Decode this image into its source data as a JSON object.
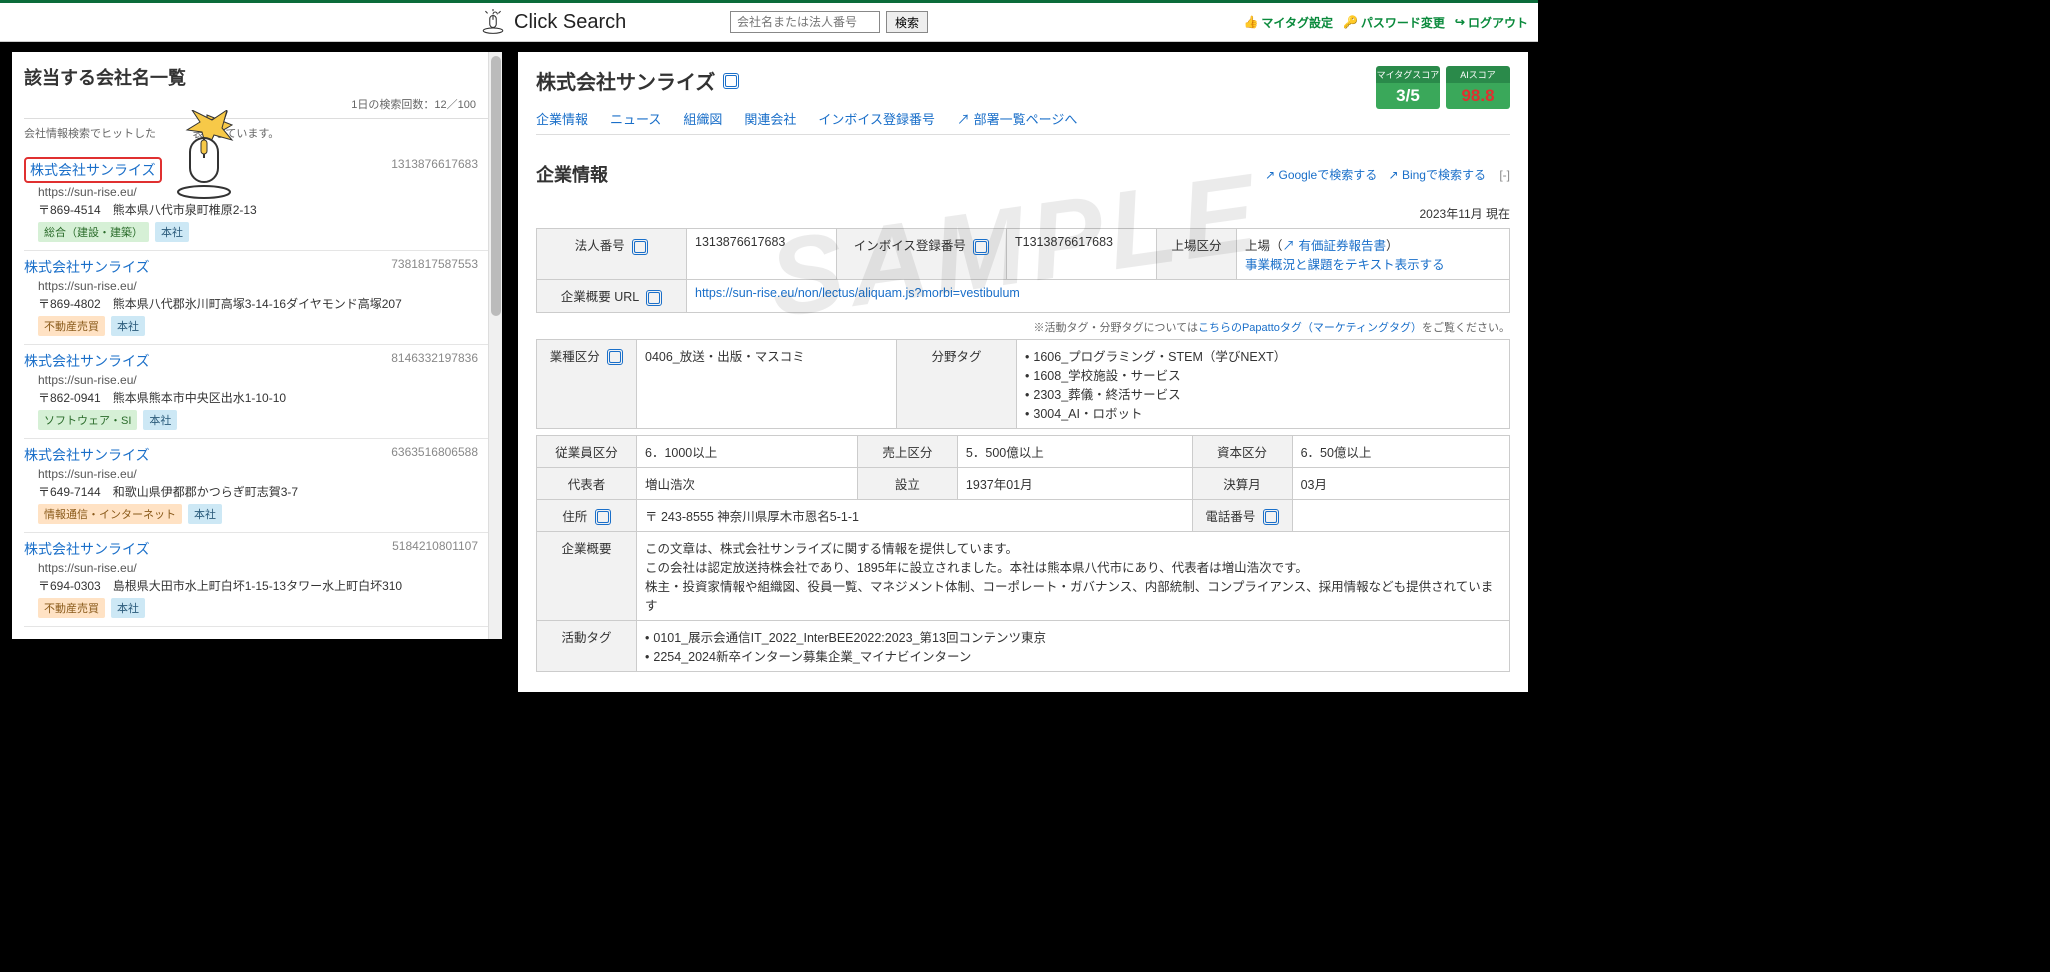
{
  "brand": "Click Search",
  "search": {
    "placeholder": "会社名または法人番号",
    "button": "検索"
  },
  "top_links": {
    "mytag": "マイタグ設定",
    "password": "パスワード変更",
    "logout": "ログアウト"
  },
  "left": {
    "title": "該当する会社名一覧",
    "count_label": "1日の検索回数：12／100",
    "note_prefix": "会社情報検索でヒットした",
    "note_suffix": "表示しています。",
    "items": [
      {
        "name": "株式会社サンライズ",
        "hojin": "1313876617683",
        "url": "https://sun-rise.eu/",
        "addr": "〒869-4514　熊本県八代市泉町椎原2-13",
        "badges": [
          {
            "text": "総合（建設・建築）",
            "cls": "badge-cat"
          },
          {
            "text": "本社",
            "cls": "badge-hq"
          }
        ],
        "boxed": true
      },
      {
        "name": "株式会社サンライズ",
        "hojin": "7381817587553",
        "url": "https://sun-rise.eu/",
        "addr": "〒869-4802　熊本県八代郡氷川町高塚3-14-16ダイヤモンド高塚207",
        "badges": [
          {
            "text": "不動産売買",
            "cls": "badge-realestate"
          },
          {
            "text": "本社",
            "cls": "badge-hq"
          }
        ]
      },
      {
        "name": "株式会社サンライズ",
        "hojin": "8146332197836",
        "url": "https://sun-rise.eu/",
        "addr": "〒862-0941　熊本県熊本市中央区出水1-10-10",
        "badges": [
          {
            "text": "ソフトウェア・SI",
            "cls": "badge-software"
          },
          {
            "text": "本社",
            "cls": "badge-hq"
          }
        ]
      },
      {
        "name": "株式会社サンライズ",
        "hojin": "6363516806588",
        "url": "https://sun-rise.eu/",
        "addr": "〒649-7144　和歌山県伊都郡かつらぎ町志賀3-7",
        "badges": [
          {
            "text": "情報通信・インターネット",
            "cls": "badge-net"
          },
          {
            "text": "本社",
            "cls": "badge-hq"
          }
        ]
      },
      {
        "name": "株式会社サンライズ",
        "hojin": "5184210801107",
        "url": "https://sun-rise.eu/",
        "addr": "〒694-0303　島根県大田市水上町白坏1-15-13タワー水上町白坏310",
        "badges": [
          {
            "text": "不動産売買",
            "cls": "badge-realestate"
          },
          {
            "text": "本社",
            "cls": "badge-hq"
          }
        ]
      }
    ]
  },
  "detail": {
    "title": "株式会社サンライズ",
    "mytag_score": "3/5",
    "mytag_label": "マイタグスコア",
    "ai_score": "98.8",
    "ai_label": "AIスコア",
    "tabs": {
      "info": "企業情報",
      "news": "ニュース",
      "org": "組織図",
      "related": "関連会社",
      "invoice": "インボイス登録番号",
      "dept": "部署一覧ページへ"
    },
    "section_title": "企業情報",
    "google": "Googleで検索する",
    "bing": "Bingで検索する",
    "collapse": "[-]",
    "asof": "2023年11月 現在",
    "row1": {
      "hojin_lbl": "法人番号",
      "hojin_val": "1313876617683",
      "invoice_lbl": "インボイス登録番号",
      "invoice_val": "T1313876617683",
      "listing_lbl": "上場区分",
      "listing_val1": "上場（",
      "listing_link": "有価証券報告書",
      "listing_val2": "）",
      "listing_sub": "事業概況と課題をテキスト表示する"
    },
    "row2": {
      "overview_url_lbl": "企業概要 URL",
      "overview_url": "https://sun-rise.eu/non/lectus/aliquam.js?morbi=vestibulum"
    },
    "tag_note_prefix": "※活動タグ・分野タグについては",
    "tag_note_link": "こちらのPapattoタグ（マーケティングタグ）",
    "tag_note_suffix": "をご覧ください。",
    "row3": {
      "industry_lbl": "業種区分",
      "industry_val": "0406_放送・出版・マスコミ",
      "field_lbl": "分野タグ",
      "fields": [
        "1606_プログラミング・STEM（学びNEXT）",
        "1608_学校施設・サービス",
        "2303_葬儀・終活サービス",
        "3004_AI・ロボット"
      ]
    },
    "row4": {
      "emp_lbl": "従業員区分",
      "emp_val": "6．1000以上",
      "sales_lbl": "売上区分",
      "sales_val": "5．500億以上",
      "cap_lbl": "資本区分",
      "cap_val": "6．50億以上"
    },
    "row5": {
      "rep_lbl": "代表者",
      "rep_val": "増山浩次",
      "est_lbl": "設立",
      "est_val": "1937年01月",
      "fy_lbl": "決算月",
      "fy_val": "03月"
    },
    "row6": {
      "addr_lbl": "住所",
      "addr_val": "〒 243-8555 神奈川県厚木市恩名5-1-1",
      "tel_lbl": "電話番号"
    },
    "row7": {
      "overview_lbl": "企業概要",
      "overview_val": "この文章は、株式会社サンライズに関する情報を提供しています。\nこの会社は認定放送持株会社であり、1895年に設立されました。本社は熊本県八代市にあり、代表者は増山浩次です。\n株主・投資家情報や組織図、役員一覧、マネジメント体制、コーポレート・ガバナンス、内部統制、コンプライアンス、採用情報なども提供されています"
    },
    "row8": {
      "activity_lbl": "活動タグ",
      "activities": [
        "0101_展示会通信IT_2022_InterBEE2022:2023_第13回コンテンツ東京",
        "2254_2024新卒インターン募集企業_マイナビインターン"
      ]
    },
    "watermark": "SAMPLE"
  }
}
